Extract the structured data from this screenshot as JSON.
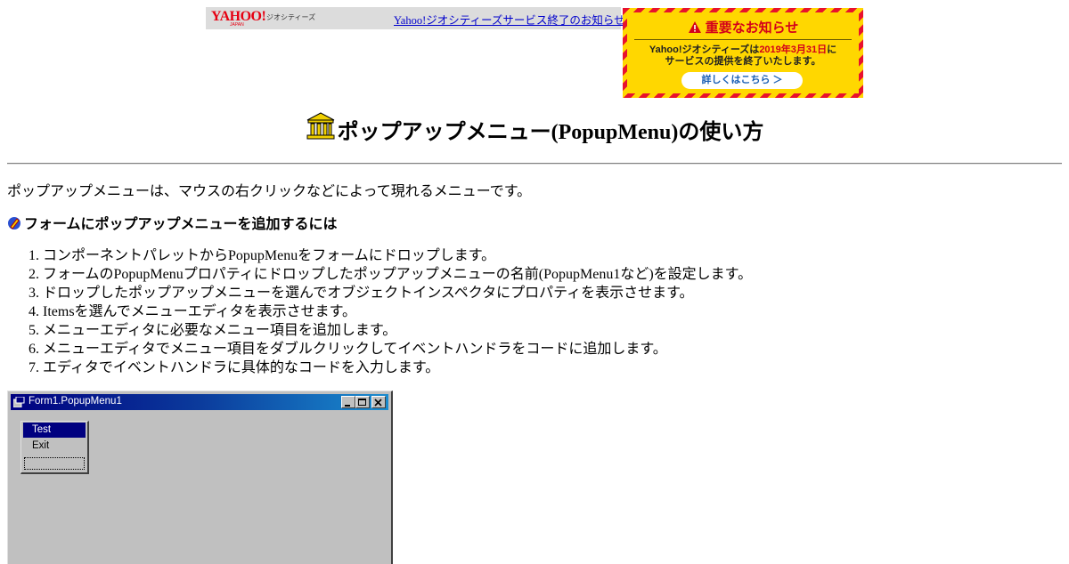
{
  "banner": {
    "logo": "YAHOO!",
    "logo_sub": "JAPAN",
    "service": "ジオシティーズ",
    "notice_link": "Yahoo!ジオシティーズサービス終了のお知らせ"
  },
  "notice": {
    "heading": "重要なお知らせ",
    "body_prefix": "Yahoo!ジオシティーズは",
    "date": "2019年3月31日",
    "body_suffix": "に",
    "body_line2": "サービスの提供を終了いたします。",
    "button": "詳しくはこちら ＞"
  },
  "page": {
    "title": "ポップアップメニュー(PopupMenu)の使い方",
    "intro": "ポップアップメニューは、マウスの右クリックなどによって現れるメニューです。",
    "subheading": "フォームにポップアップメニューを追加するには",
    "steps": [
      "コンポーネントパレットからPopupMenuをフォームにドロップします。",
      "フォームのPopupMenuプロパティにドロップしたポップアップメニューの名前(PopupMenu1など)を設定します。",
      "ドロップしたポップアップメニューを選んでオブジェクトインスペクタにプロパティを表示させます。",
      "Itemsを選んでメニューエディタを表示させます。",
      "メニューエディタに必要なメニュー項目を追加します。",
      "メニューエディタでメニュー項目をダブルクリックしてイベントハンドラをコードに追加します。",
      "エディタでイベントハンドラに具体的なコードを入力します。"
    ]
  },
  "form": {
    "title": "Form1.PopupMenu1",
    "menu_items": [
      "Test",
      "Exit"
    ]
  }
}
